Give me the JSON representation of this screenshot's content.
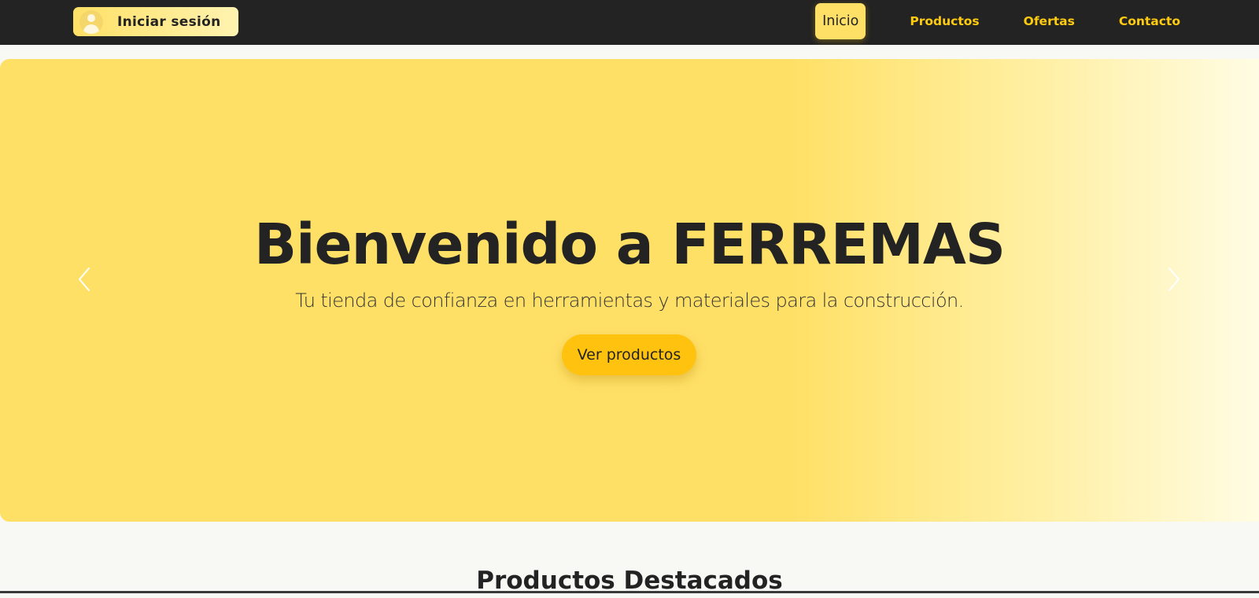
{
  "header": {
    "login_label": "Iniciar sesión",
    "login_icon": "user-icon",
    "nav": [
      {
        "label": "Inicio",
        "active": true
      },
      {
        "label": "Productos",
        "active": false
      },
      {
        "label": "Ofertas",
        "active": false
      },
      {
        "label": "Contacto",
        "active": false
      }
    ]
  },
  "hero": {
    "title": "Bienvenido a FERREMAS",
    "subtitle": "Tu tienda de confianza en herramientas y materiales para la construcción.",
    "cta_label": "Ver productos",
    "prev_icon": "chevron-left-icon",
    "next_icon": "chevron-right-icon"
  },
  "featured": {
    "title": "Productos Destacados"
  },
  "colors": {
    "nav_background": "#232323",
    "accent_yellow": "#ffe066",
    "nav_link": "#ffcb0f",
    "cta": "#ffc20e",
    "page_background": "#f8f8f5"
  }
}
